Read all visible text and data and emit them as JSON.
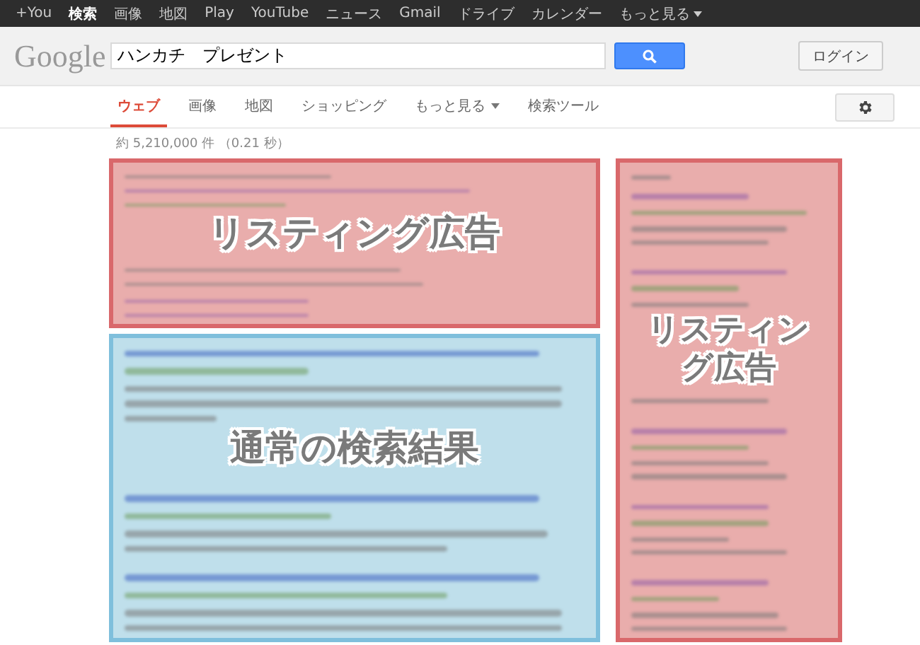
{
  "top_bar": {
    "items": [
      {
        "label": "+You",
        "selected": false,
        "dropdown": false
      },
      {
        "label": "検索",
        "selected": true,
        "dropdown": false
      },
      {
        "label": "画像",
        "selected": false,
        "dropdown": false
      },
      {
        "label": "地図",
        "selected": false,
        "dropdown": false
      },
      {
        "label": "Play",
        "selected": false,
        "dropdown": false
      },
      {
        "label": "YouTube",
        "selected": false,
        "dropdown": false
      },
      {
        "label": "ニュース",
        "selected": false,
        "dropdown": false
      },
      {
        "label": "Gmail",
        "selected": false,
        "dropdown": false
      },
      {
        "label": "ドライブ",
        "selected": false,
        "dropdown": false
      },
      {
        "label": "カレンダー",
        "selected": false,
        "dropdown": false
      },
      {
        "label": "もっと見る",
        "selected": false,
        "dropdown": true
      }
    ]
  },
  "header": {
    "logo": "Google",
    "search": {
      "value": "ハンカチ　プレゼント"
    },
    "login_button": "ログイン"
  },
  "tabs": [
    {
      "label": "ウェブ",
      "selected": true,
      "dropdown": false
    },
    {
      "label": "画像",
      "selected": false,
      "dropdown": false
    },
    {
      "label": "地図",
      "selected": false,
      "dropdown": false
    },
    {
      "label": "ショッピング",
      "selected": false,
      "dropdown": false
    },
    {
      "label": "もっと見る",
      "selected": false,
      "dropdown": true
    },
    {
      "label": "検索ツール",
      "selected": false,
      "dropdown": false
    }
  ],
  "result_stats": "約 5,210,000 件 （0.21 秒）",
  "main_column": [
    {
      "kind": "ad",
      "label": "リスティング広告"
    },
    {
      "kind": "organic",
      "label": "通常の検索結果"
    }
  ],
  "side_column": [
    {
      "kind": "ad",
      "label": "リスティング広告"
    }
  ]
}
